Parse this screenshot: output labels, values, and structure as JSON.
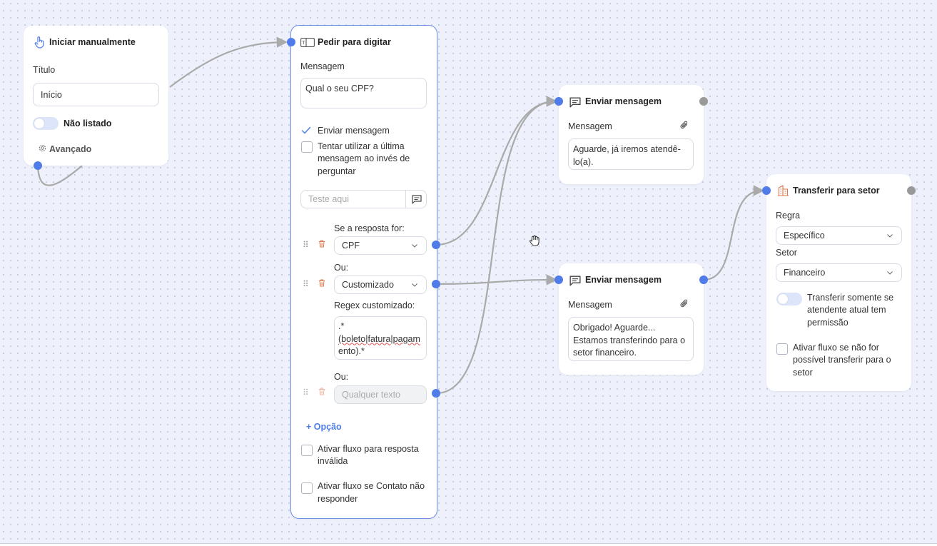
{
  "nodes": {
    "start": {
      "title": "Iniciar manualmente",
      "titulo_label": "Título",
      "titulo_value": "Início",
      "nao_listado_label": "Não listado",
      "avancado_label": "Avançado"
    },
    "ask": {
      "title": "Pedir para digitar",
      "mensagem_label": "Mensagem",
      "mensagem_value": "Qual o seu CPF?",
      "enviar_mensagem_label": "Enviar mensagem",
      "tentar_label_1": "Tentar utilizar a última",
      "tentar_label_2": "mensagem ao invés de",
      "tentar_label_3": "perguntar",
      "teste_placeholder": "Teste aqui",
      "se_resposta_label": "Se a resposta for:",
      "option1_value": "CPF",
      "ou_label_1": "Ou:",
      "option2_value": "Customizado",
      "regex_label": "Regex customizado:",
      "regex_line1": ".*",
      "regex_line2": "(boleto|fatura|pagam",
      "regex_line3": "ento).*",
      "ou_label_2": "Ou:",
      "option3_placeholder": "Qualquer texto",
      "add_option_label": "+ Opção",
      "invalid_label_1": "Ativar fluxo para resposta",
      "invalid_label_2": "inválida",
      "noreply_label_1": "Ativar fluxo se Contato não",
      "noreply_label_2": "responder"
    },
    "msg1": {
      "title": "Enviar mensagem",
      "mensagem_label": "Mensagem",
      "text_line1": "Aguarde, já iremos atendê-",
      "text_line2": "lo(a)."
    },
    "msg2": {
      "title": "Enviar mensagem",
      "mensagem_label": "Mensagem",
      "text_line1": "Obrigado! Aguarde...",
      "text_line2": "Estamos transferindo para o",
      "text_line3": "setor financeiro."
    },
    "transfer": {
      "title": "Transferir para setor",
      "regra_label": "Regra",
      "regra_value": "Específico",
      "setor_label": "Setor",
      "setor_value": "Financeiro",
      "toggle_label_1": "Transferir somente se",
      "toggle_label_2": "atendente atual tem",
      "toggle_label_3": "permissão",
      "fallback_label_1": "Ativar fluxo se não for",
      "fallback_label_2": "possível transferir para o",
      "fallback_label_3": "setor"
    }
  },
  "colors": {
    "accent": "#4f7ce8",
    "port_grey": "#999999",
    "wire": "#aaaaaa",
    "transfer_icon": "#e0734a"
  }
}
